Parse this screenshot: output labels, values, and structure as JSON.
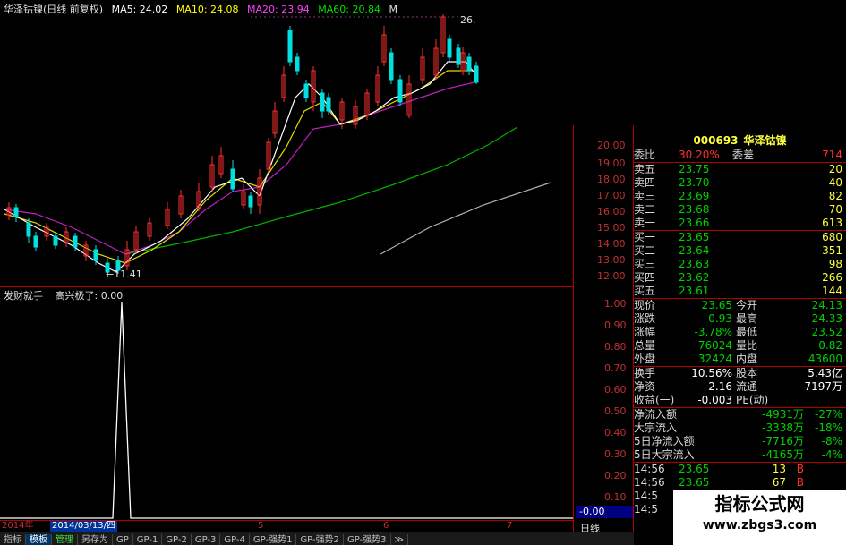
{
  "title": {
    "name": "华泽钴镍(日线 前复权)",
    "ma5": "MA5: 24.02",
    "ma10": "MA10: 24.08",
    "ma20": "MA20: 23.94",
    "ma60": "MA60: 20.84",
    "ma_more": "M"
  },
  "main_chart": {
    "high_label": "26.",
    "low_label": "←11.41",
    "y_ticks": [
      "20.00",
      "19.00",
      "18.00",
      "17.00",
      "16.00",
      "15.00",
      "14.00",
      "13.00",
      "12.00"
    ]
  },
  "indicator": {
    "title": "发财就手",
    "value_label": "高兴极了: 0.00",
    "y_ticks": [
      "1.00",
      "0.90",
      "0.80",
      "0.70",
      "0.60",
      "0.50",
      "0.40",
      "0.30",
      "0.20",
      "0.10"
    ],
    "current_value": "-0.00"
  },
  "timeline": {
    "left_stub": "2014年",
    "date": "2014/03/13/四",
    "months": [
      "5",
      "6",
      "7"
    ],
    "period": "日线"
  },
  "quote": {
    "code": "000693",
    "name": "华泽钴镍",
    "weibi_label": "委比",
    "weibi_value": "30.20%",
    "weicha_label": "委差",
    "weicha_value": "714",
    "asks": [
      {
        "label": "卖五",
        "price": "23.75",
        "vol": "20"
      },
      {
        "label": "卖四",
        "price": "23.70",
        "vol": "40"
      },
      {
        "label": "卖三",
        "price": "23.69",
        "vol": "82"
      },
      {
        "label": "卖二",
        "price": "23.68",
        "vol": "70"
      },
      {
        "label": "卖一",
        "price": "23.66",
        "vol": "613"
      }
    ],
    "bids": [
      {
        "label": "买一",
        "price": "23.65",
        "vol": "680"
      },
      {
        "label": "买二",
        "price": "23.64",
        "vol": "351"
      },
      {
        "label": "买三",
        "price": "23.63",
        "vol": "98"
      },
      {
        "label": "买四",
        "price": "23.62",
        "vol": "266"
      },
      {
        "label": "买五",
        "price": "23.61",
        "vol": "144"
      }
    ],
    "stats": [
      {
        "l1": "现价",
        "v1": "23.65",
        "l2": "今开",
        "v2": "24.13"
      },
      {
        "l1": "涨跌",
        "v1": "-0.93",
        "l2": "最高",
        "v2": "24.33"
      },
      {
        "l1": "涨幅",
        "v1": "-3.78%",
        "l2": "最低",
        "v2": "23.52"
      },
      {
        "l1": "总量",
        "v1": "76024",
        "l2": "量比",
        "v2": "0.82"
      },
      {
        "l1": "外盘",
        "v1": "32424",
        "l2": "内盘",
        "v2": "43600"
      }
    ],
    "fund": [
      {
        "l1": "换手",
        "v1": "10.56%",
        "l2": "股本",
        "v2": "5.43亿"
      },
      {
        "l1": "净资",
        "v1": "2.16",
        "l2": "流通",
        "v2": "7197万"
      },
      {
        "l1": "收益(一)",
        "v1": "-0.003",
        "l2": "PE(动)",
        "v2": ""
      }
    ],
    "flows": [
      {
        "label": "净流入额",
        "value": "-4931万",
        "pct": "-27%"
      },
      {
        "label": "大宗流入",
        "value": "-3338万",
        "pct": "-18%"
      },
      {
        "label": "5日净流入额",
        "value": "-7716万",
        "pct": "-8%"
      },
      {
        "label": "5日大宗流入",
        "value": "-4165万",
        "pct": "-4%"
      }
    ],
    "ticks": [
      {
        "time": "14:56",
        "price": "23.65",
        "vol": "13",
        "side": "B"
      },
      {
        "time": "14:56",
        "price": "23.65",
        "vol": "67",
        "side": "B"
      },
      {
        "time": "14:5",
        "price": "",
        "vol": "",
        "side": ""
      },
      {
        "time": "14:5",
        "price": "",
        "vol": "",
        "side": ""
      }
    ]
  },
  "bottom_tabs": [
    "指标",
    "模板",
    "管理",
    "另存为",
    "GP",
    "GP-1",
    "GP-2",
    "GP-3",
    "GP-4",
    "GP-强势1",
    "GP-强势2",
    "GP-强势3",
    "≫"
  ],
  "watermark": {
    "line1": "指标公式网",
    "line2": "www.zbgs3.com"
  },
  "colors": {
    "up": "#ff3030",
    "down": "#00e0e0",
    "ma5": "#ffffff",
    "ma10": "#ffff00",
    "ma20": "#ff00ff",
    "ma60": "#00c000"
  }
}
